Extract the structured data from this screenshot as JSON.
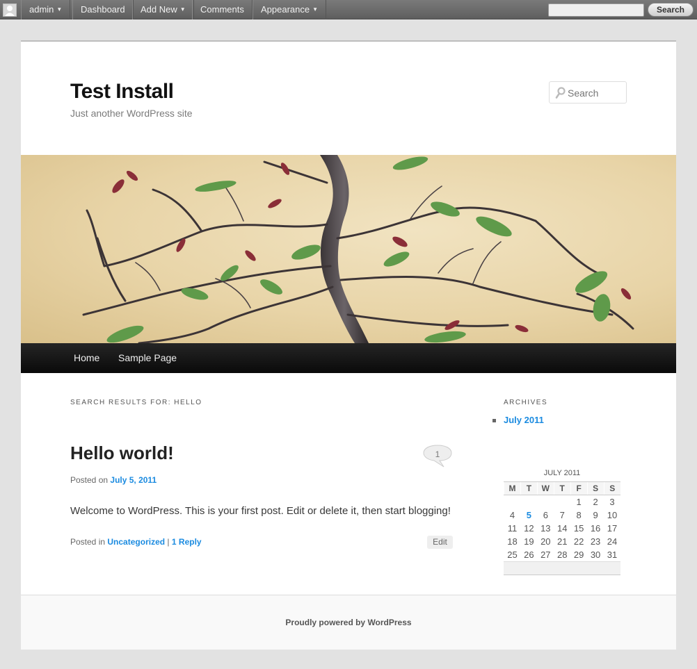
{
  "admin_bar": {
    "user_label": "admin",
    "menu": [
      "Dashboard",
      "Add New",
      "Comments",
      "Appearance"
    ],
    "search_value": "",
    "search_button": "Search"
  },
  "site": {
    "title": "Test Install",
    "description": "Just another WordPress site",
    "search_placeholder": "Search"
  },
  "nav": [
    "Home",
    "Sample Page"
  ],
  "main": {
    "search_heading": "SEARCH RESULTS FOR: HELLO",
    "post": {
      "title": "Hello world!",
      "comment_count": "1",
      "posted_on_prefix": "Posted on",
      "date": "July 5, 2011",
      "body": "Welcome to WordPress. This is your first post. Edit or delete it, then start blogging!",
      "posted_in_prefix": "Posted in",
      "category": "Uncategorized",
      "separator": "|",
      "reply": "1 Reply",
      "edit": "Edit"
    }
  },
  "sidebar": {
    "archives_title": "ARCHIVES",
    "archives": [
      "July 2011"
    ],
    "calendar": {
      "caption": "JULY 2011",
      "headers": [
        "M",
        "T",
        "W",
        "T",
        "F",
        "S",
        "S"
      ],
      "weeks": [
        [
          "",
          "",
          "",
          "",
          "1",
          "2",
          "3"
        ],
        [
          "4",
          "5",
          "6",
          "7",
          "8",
          "9",
          "10"
        ],
        [
          "11",
          "12",
          "13",
          "14",
          "15",
          "16",
          "17"
        ],
        [
          "18",
          "19",
          "20",
          "21",
          "22",
          "23",
          "24"
        ],
        [
          "25",
          "26",
          "27",
          "28",
          "29",
          "30",
          "31"
        ]
      ],
      "linked_day": "5"
    }
  },
  "footer": {
    "text": "Proudly powered by WordPress"
  },
  "colors": {
    "link": "#1b8be0",
    "nav_bg": "#111111",
    "admin_bar_bg": "#6b6b6b"
  }
}
